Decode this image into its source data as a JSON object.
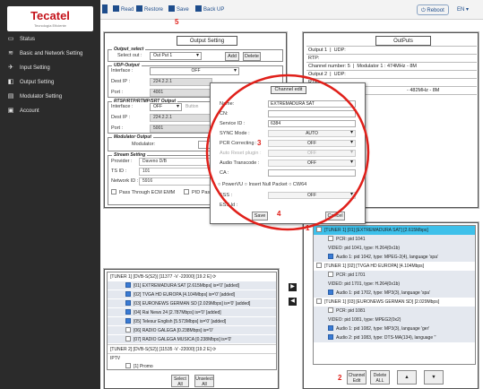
{
  "app": {
    "logo": "Tecatel",
    "logo_sub": "Tecnología Eficiente"
  },
  "sidebar": {
    "items": [
      {
        "label": "Status",
        "icon": "monitor-icon"
      },
      {
        "label": "Basic and Network Setting",
        "icon": "wifi-icon"
      },
      {
        "label": "Input Setting",
        "icon": "satellite-icon"
      },
      {
        "label": "Output Setting",
        "icon": "output-icon"
      },
      {
        "label": "Modulator Setting",
        "icon": "modulator-icon"
      },
      {
        "label": "Account",
        "icon": "account-icon"
      }
    ]
  },
  "toolbar": {
    "read": "Read",
    "restore": "Restore",
    "save": "Save",
    "backup": "Back UP",
    "reboot": "Reboot",
    "lang": "EN",
    "anno": "5"
  },
  "output_setting": {
    "tab": "Output Setting",
    "select": {
      "legend": "Output_select",
      "label": "Select out :",
      "value": "Out Put 1",
      "add": "Add",
      "delete": "Delete"
    },
    "udp": {
      "legend": "UDP-Output",
      "interface_label": "Interface :",
      "interface_value": "OFF",
      "dest_ip_label": "Dest IP :",
      "dest_ip": "224.2.2.1",
      "port_label": "Port :",
      "port": "4001"
    },
    "rtsp": {
      "legend": "RTSP/RTP/RTMP/SRT Output",
      "interface_label": "Interface :",
      "interface_value": "OFF",
      "button": "Button",
      "dest_ip_label": "Dest IP :",
      "dest_ip": "224.2.2.1",
      "port_label": "Port :",
      "port": "5001"
    },
    "modulator": {
      "legend": "Modulator Output",
      "label": "Modulator:"
    },
    "stream": {
      "legend": "Stream Setting",
      "provider_label": "Provider :",
      "provider": "Daveno D/B",
      "tsid_label": "TS ID :",
      "tsid": "101",
      "netid_label": "Network ID :",
      "netid": "5916",
      "pass_emm": "Pass Through ECM EMM",
      "pid_pass": "PID Passthrough"
    }
  },
  "outputs": {
    "tab": "OutPuts",
    "rows": [
      {
        "col1": "Output 1",
        "col2": "UDP:"
      },
      {
        "col1": "RTP:",
        "col2": ""
      },
      {
        "col1": "Channel number: 5",
        "col2": "Modulator 1 : 474MHz - 8M"
      },
      {
        "col1": "Output 2",
        "col2": "UDP:"
      },
      {
        "col1": "RTP:",
        "col2": ""
      },
      {
        "col1": "",
        "col2": "- 482MHz - 8M"
      }
    ]
  },
  "channel_edit": {
    "title": "Channel edit",
    "fields": [
      {
        "label": "Name:",
        "value": "EXTREMADURA SAT",
        "kind": "input"
      },
      {
        "label": "CN:",
        "value": "",
        "kind": "input"
      },
      {
        "label": "Service ID :",
        "value": "6384",
        "kind": "input"
      },
      {
        "label": "SYNC Mode :",
        "value": "AUTO",
        "kind": "select"
      },
      {
        "label": "PCR Correcting :",
        "value": "OFF",
        "kind": "select"
      },
      {
        "label": "Auto Reset plugin :",
        "value": "OFF",
        "kind": "select-disabled"
      },
      {
        "label": "Audio Transcode :",
        "value": "OFF",
        "kind": "select"
      },
      {
        "label": "CA :",
        "value": "",
        "kind": "input"
      },
      {
        "label": "ESS :",
        "value": "OFF",
        "kind": "select"
      },
      {
        "label": "ESS Id :",
        "value": "",
        "kind": "input"
      }
    ],
    "radios": "○ PowerVU ○ Insert Null Packet ○ CW64",
    "save": "Save",
    "cancel": "Cancel",
    "anno3": "3",
    "anno4": "4"
  },
  "input_tree": {
    "tuners": [
      {
        "label": "[TUNER 1] [DVB-S(S2)] [11377 -V -22000] [19.2 E]",
        "channels": [
          {
            "label": "[01] EXTREMADURA SAT [2.615Mbps] is='0' [added]",
            "checked": true
          },
          {
            "label": "[02] TVGA HD EUROPA [4.104Mbps] is='0' [added]",
            "checked": true
          },
          {
            "label": "[03] EURONEWS GERMAN SD [2.029Mbps] is='0' [added]",
            "checked": true
          },
          {
            "label": "[04] Rai News 24 [2.787Mbps] is='0' [added]",
            "checked": true
          },
          {
            "label": "[05] Telesur English [5.573Mbps] is='0' [added]",
            "checked": true
          },
          {
            "label": "[06] RADIO GALEGA [0.238Mbps] is='0'",
            "checked": false
          },
          {
            "label": "[07] RADIO GALEGA MUSICA [0.238Mbps] is='0'",
            "checked": false
          }
        ]
      },
      {
        "label": "[TUNER 2] [DVB-S(S2)] [11535 -V -22000] [19.2 E]",
        "channels": []
      }
    ],
    "iptv": "IPTV",
    "promo": "[1] Promo",
    "select_all": "Select All",
    "unselect_all": "Unselect All"
  },
  "output_tree": {
    "anno1": "1",
    "channels": [
      {
        "label": "[TUNER 1] [01] [EXTREMADURA SAT] [2.615Mbps]",
        "highlight": true,
        "subs": [
          {
            "label": "PCR: pid 1041",
            "checked": false
          },
          {
            "label": "VIDEO: pid 1041, type: H.264(0x1b)",
            "checked": null
          },
          {
            "label": "Audio 1: pid 1042, type: MPEG-2(4), language 'spa'",
            "checked": true
          }
        ]
      },
      {
        "label": "[TUNER 1] [02] [TVGA HD EUROPA] [4.104Mbps]",
        "highlight": false,
        "subs": [
          {
            "label": "PCR: pid 1701",
            "checked": false
          },
          {
            "label": "VIDEO: pid 1701, type: H.264(0x1b)",
            "checked": null
          },
          {
            "label": "Audio 1: pid 1702, type: MP3(3), language 'spa'",
            "checked": true
          }
        ]
      },
      {
        "label": "[TUNER 1] [03] [EURONEWS GERMAN SD] [2.029Mbps]",
        "highlight": false,
        "subs": [
          {
            "label": "PCR: pid 1081",
            "checked": false
          },
          {
            "label": "VIDEO: pid 1081, type: MPEG2(0x2)",
            "checked": null
          },
          {
            "label": "Audio 1: pid 1082, type: MP3(3), language 'ger'",
            "checked": true
          },
          {
            "label": "Audio 2: pid 1083, type: DTS-MA(134), language ''",
            "checked": true
          }
        ]
      }
    ],
    "channel_edit": "Channel Edit",
    "delete_all": "Delete ALL",
    "up": "▲",
    "down": "▼",
    "anno2": "2"
  },
  "colors": {
    "sidebar": "#2b2b2b",
    "accent": "#1e4d8c",
    "annotation": "#e0201a",
    "highlight": "#3ec0ea"
  }
}
